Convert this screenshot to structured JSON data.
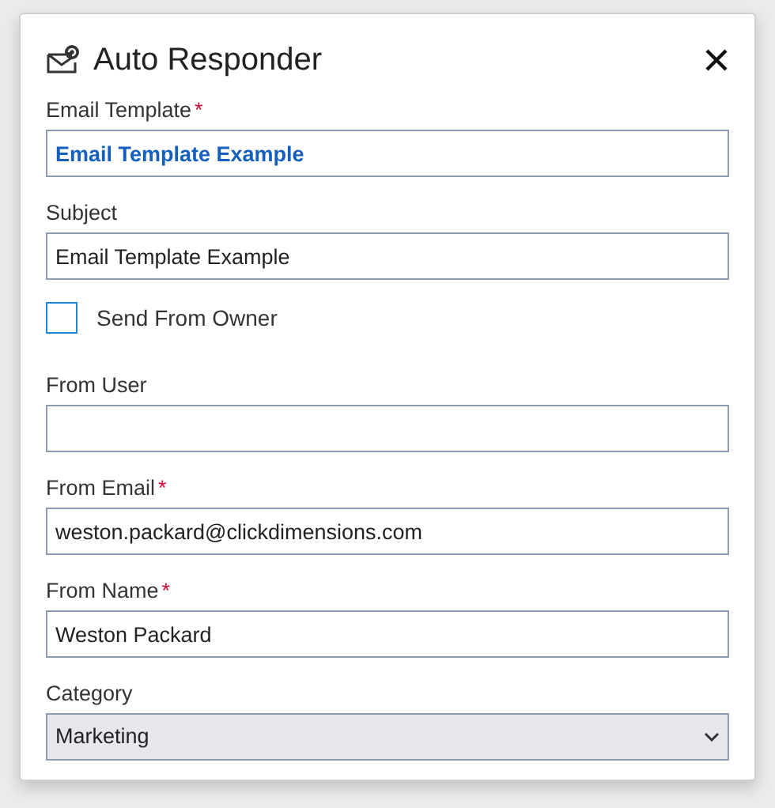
{
  "dialog": {
    "title": "Auto Responder"
  },
  "fields": [
    {
      "kind": "lookup",
      "label": "Email Template",
      "required_mark": "*",
      "value": "Email Template Example"
    },
    {
      "kind": "text",
      "label": "Subject",
      "value": "Email Template Example"
    },
    {
      "kind": "checkbox",
      "label": "Send From Owner",
      "checked": false
    },
    {
      "kind": "text",
      "label": "From User"
    },
    {
      "kind": "text",
      "label": "From Email",
      "required_mark": "*",
      "value": "weston.packard@clickdimensions.com"
    },
    {
      "kind": "text",
      "label": "From Name",
      "required_mark": "*",
      "value": "Weston Packard"
    },
    {
      "kind": "select",
      "label": "Category",
      "value": "Marketing"
    }
  ]
}
